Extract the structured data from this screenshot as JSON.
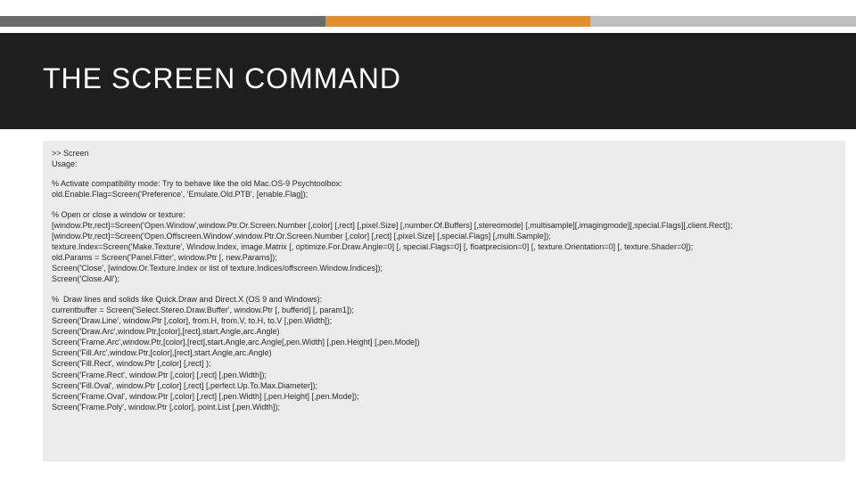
{
  "title": "THE SCREEN COMMAND",
  "code": {
    "block0": {
      "l0": ">> Screen",
      "l1": "Usage:"
    },
    "block1": {
      "l0": "% Activate compatibility mode: Try to behave like the old Mac.OS-9 Psychtoolbox:",
      "l1": "old.Enable.Flag=Screen('Preference', 'Emulate.Old.PTB', [enable.Flag]);"
    },
    "block2": {
      "l0": "% Open or close a window or texture:",
      "l1": "[window.Ptr,rect]=Screen('Open.Window',window.Ptr.Or.Screen.Number [,color] [,rect] [,pixel.Size] [,number.Of.Buffers] [,stereomode] [,multisample][,imagingmode][,special.Flags][,client.Rect]);",
      "l2": "[window.Ptr,rect]=Screen('Open.Offscreen.Window',window.Ptr.Or.Screen.Number [,color] [,rect] [,pixel.Size] [,special.Flags] [,multi.Sample]);",
      "l3": "texture.Index=Screen('Make.Texture', Window.Index, image.Matrix [, optimize.For.Draw.Angle=0] [, special.Flags=0] [, floatprecision=0] [, texture.Orientation=0] [, texture.Shader=0]);",
      "l4": "old.Params = Screen('Panel.Fitter', window.Ptr [, new.Params]);",
      "l5": "Screen('Close', [window.Or.Texture.Index or list of texture.Indices/offscreen.Window.Indices]);",
      "l6": "Screen('Close.All');"
    },
    "block3": {
      "l0": "%  Draw lines and solids like Quick.Draw and Direct.X (OS 9 and Windows):",
      "l1": "currentbuffer = Screen('Select.Stereo.Draw.Buffer', window.Ptr [, bufferid] [, param1]);",
      "l2": "Screen('Draw.Line', window.Ptr [,color], from.H, from.V, to.H, to.V [,pen.Width]);",
      "l3": "Screen('Draw.Arc',window.Ptr,[color],[rect],start.Angle,arc.Angle)",
      "l4": "Screen('Frame.Arc',window.Ptr,[color],[rect],start.Angle,arc.Angle[,pen.Width] [,pen.Height] [,pen.Mode])",
      "l5": "Screen('Fill.Arc',window.Ptr,[color],[rect],start.Angle,arc.Angle)",
      "l6": "Screen('Fill.Rect', window.Ptr [,color] [,rect] );",
      "l7": "Screen('Frame.Rect', window.Ptr [,color] [,rect] [,pen.Width]);",
      "l8": "Screen('Fill.Oval', window.Ptr [,color] [,rect] [,perfect.Up.To.Max.Diameter]);",
      "l9": "Screen('Frame.Oval', window.Ptr [,color] [,rect] [,pen.Width] [,pen.Height] [,pen.Mode]);",
      "l10": "Screen('Frame.Poly', window.Ptr [,color], point.List [,pen.Width]);"
    }
  }
}
